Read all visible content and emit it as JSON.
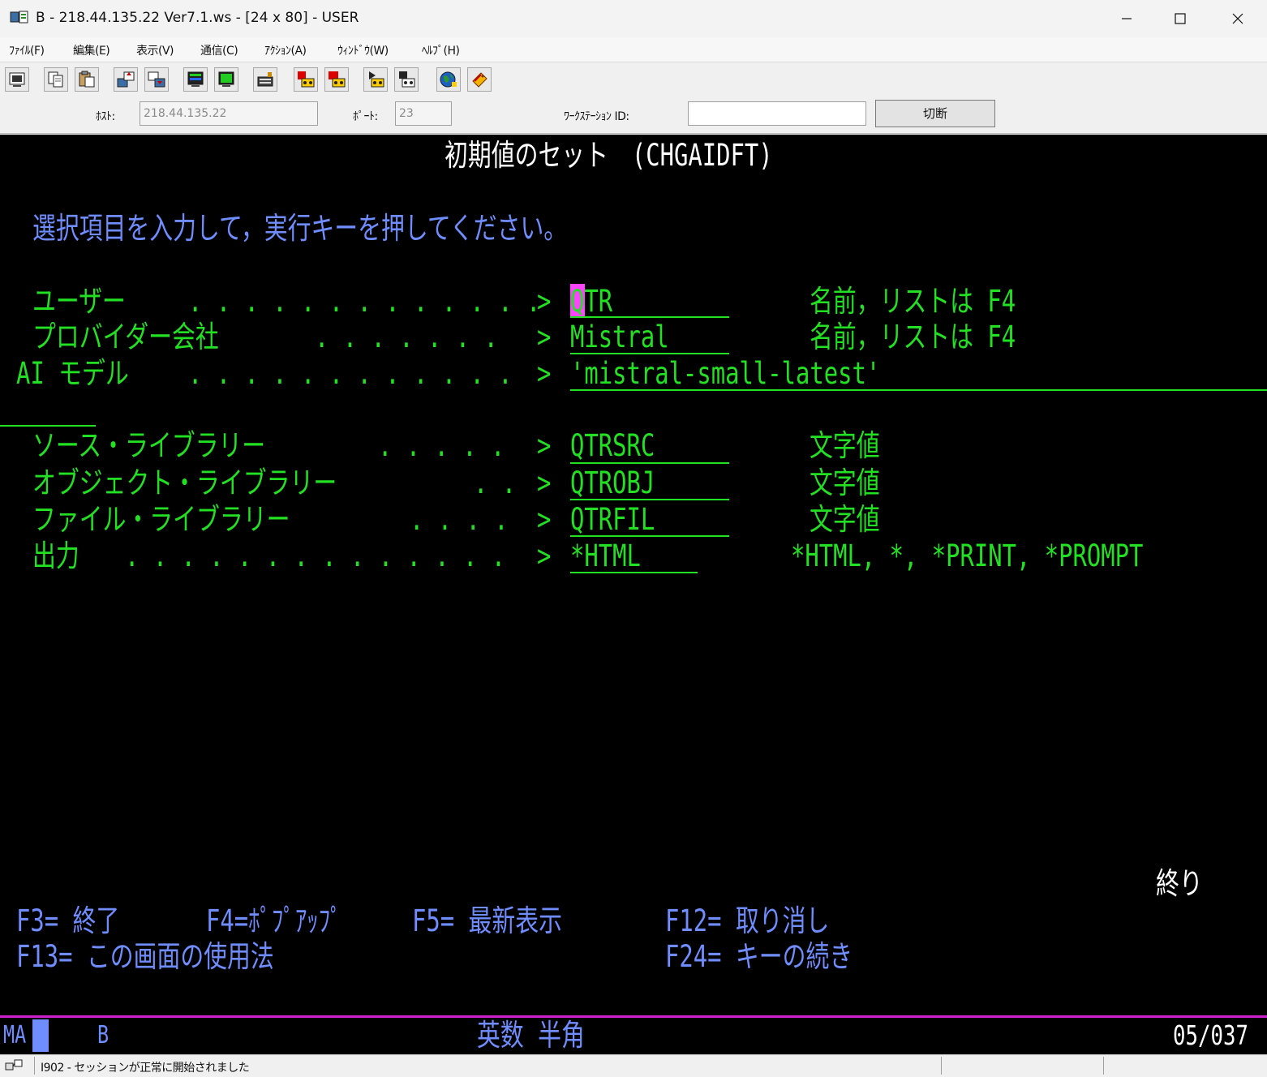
{
  "window": {
    "title": "B - 218.44.135.22 Ver7.1.ws - [24 x 80] - USER",
    "minimize": "—",
    "maximize": "☐",
    "close": "✕"
  },
  "menu": {
    "items": [
      "ﾌｧｲﾙ(F)",
      "編集(E)",
      "表示(V)",
      "通信(C)",
      "ｱｸｼｮﾝ(A)",
      "ｳｨﾝﾄﾞｳ(W)",
      "ﾍﾙﾌﾟ(H)"
    ]
  },
  "toolbar": {
    "icons": [
      "print-screen-icon",
      "copy-icon",
      "paste-icon",
      "send-file-icon",
      "receive-file-icon",
      "display-setup-icon",
      "keyboard-setup-icon",
      "macro-icon",
      "record-macro-icon",
      "stop-macro-icon",
      "play-macro-icon",
      "pause-macro-icon",
      "globe-icon",
      "help-icon"
    ]
  },
  "connection": {
    "host_label": "ﾎｽﾄ:",
    "host_value": "218.44.135.22",
    "port_label": "ﾎﾟｰﾄ:",
    "port_value": "23",
    "workstation_label": "ﾜｰｸｽﾃｰｼｮﾝ ID:",
    "workstation_value": "",
    "disconnect_label": "切断"
  },
  "screen": {
    "title": "初期値のセット　(CHGAIDFT)",
    "instruction": "選択項目を入力して，実行キーを押してください。",
    "fields": {
      "user": {
        "label": "ユーザー",
        "dots": ". . . . . . . . . . . . .",
        "value": "QTR",
        "hint": "名前，リストは F4"
      },
      "provider": {
        "label": "プロバイダー会社",
        "dots": ". . . . . . .",
        "value": "Mistral",
        "hint": "名前，リストは F4"
      },
      "model": {
        "label": "AI モデル",
        "dots": ". . . . . . . . . . . .",
        "value": "'mistral-small-latest'"
      },
      "source_lib": {
        "label": "ソース・ライブラリー",
        "dots": ". . . . .",
        "value": "QTRSRC",
        "hint": "文字値"
      },
      "object_lib": {
        "label": "オブジェクト・ライブラリー",
        "dots": ". .",
        "value": "QTROBJ",
        "hint": "文字値"
      },
      "file_lib": {
        "label": "ファイル・ライブラリー",
        "dots": ". . . .",
        "value": "QTRFIL",
        "hint": "文字値"
      },
      "output": {
        "label": "出力",
        "dots": ". . . . . . . . . . . . . .",
        "value": "*HTML",
        "hint": "*HTML, *, *PRINT, *PROMPT"
      }
    },
    "prompt_marker": ">",
    "end_label": "終り",
    "fkeys": {
      "f3": "F3= 終了",
      "f4": "F4=ﾎﾟﾌﾟｱｯﾌﾟ",
      "f5": "F5= 最新表示",
      "f12": "F12= 取り消し",
      "f13": "F13= この画面の使用法",
      "f24": "F24= キーの続き"
    }
  },
  "oia": {
    "ma": "MA",
    "session": "B",
    "mode": "英数 半角",
    "cursor_position": "05/037"
  },
  "status": {
    "message": "I902 - セッションが正常に開始されました"
  },
  "colors": {
    "terminal_green": "#22e022",
    "terminal_blue": "#6f8dff",
    "cursor_pink": "#ff44ff",
    "oia_line": "#d020d0"
  }
}
